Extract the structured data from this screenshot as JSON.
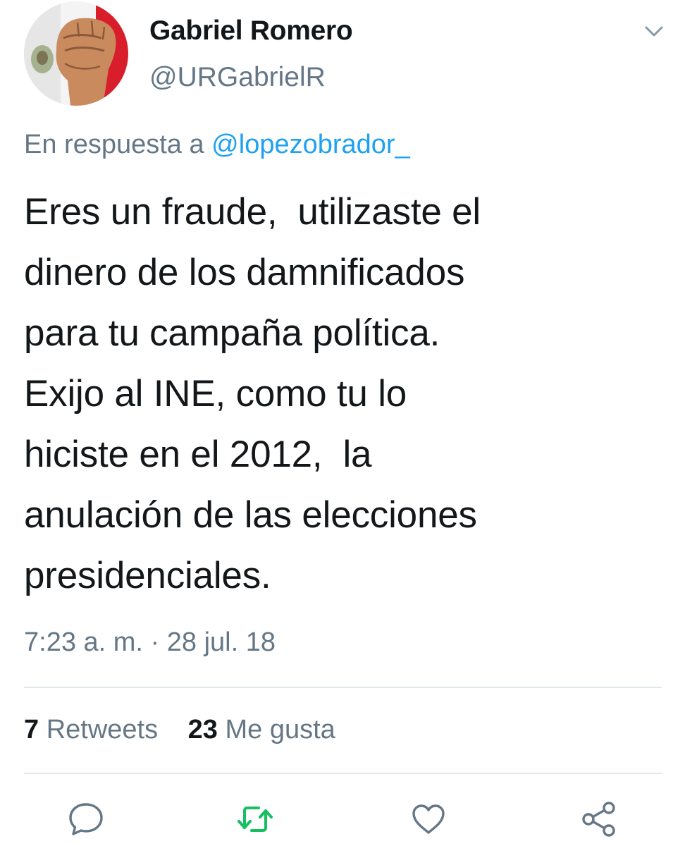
{
  "user": {
    "display_name": "Gabriel Romero",
    "handle": "@URGabrielR"
  },
  "reply_context": {
    "prefix": "En respuesta a",
    "mention": "@lopezobrador_"
  },
  "tweet": {
    "lines": [
      "Eres un fraude,  utilizaste el",
      "dinero de los damnificados",
      "para tu campaña política.",
      "Exijo al INE, como tu lo",
      "hiciste en el 2012,  la",
      "anulación de las elecciones",
      "presidenciales."
    ],
    "timestamp": "7:23 a. m. · 28 jul. 18"
  },
  "stats": {
    "retweets_count": "7",
    "retweets_label": "Retweets",
    "likes_count": "23",
    "likes_label": "Me gusta"
  },
  "actions": {
    "reply_icon": "speech-bubble-icon",
    "retweet_icon": "retweet-icon",
    "like_icon": "heart-icon",
    "share_icon": "share-icon"
  },
  "colors": {
    "text": "#14171a",
    "secondary": "#657786",
    "link": "#1da1f2",
    "retweet_green": "#17bf63",
    "divider": "#e1e8ed"
  }
}
